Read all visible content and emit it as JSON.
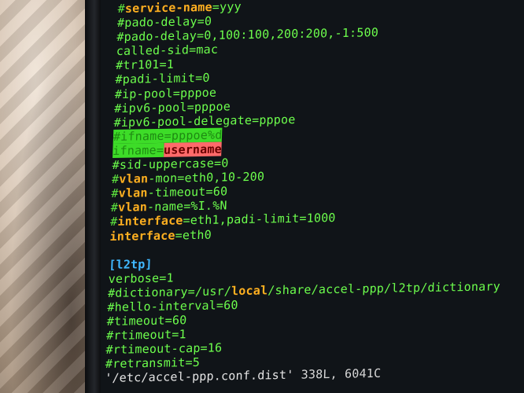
{
  "lines": [
    {
      "segs": [
        {
          "t": "#",
          "k": "c"
        },
        {
          "t": "service-name",
          "k": "kw"
        },
        {
          "t": "=yyy",
          "k": "val"
        }
      ]
    },
    {
      "segs": [
        {
          "t": "#pado-delay=0",
          "k": "val"
        }
      ]
    },
    {
      "segs": [
        {
          "t": "#pado-delay=0,100:100,200:200,-1:500",
          "k": "val"
        }
      ]
    },
    {
      "segs": [
        {
          "t": "called-sid=mac",
          "k": "val"
        }
      ]
    },
    {
      "segs": [
        {
          "t": "#tr101=1",
          "k": "val"
        }
      ]
    },
    {
      "segs": [
        {
          "t": "#padi-limit=0",
          "k": "val"
        }
      ]
    },
    {
      "segs": [
        {
          "t": "#ip-pool=pppoe",
          "k": "val"
        }
      ]
    },
    {
      "segs": [
        {
          "t": "#ipv6-pool=pppoe",
          "k": "val"
        }
      ]
    },
    {
      "segs": [
        {
          "t": "#ipv6-pool-delegate=pppoe",
          "k": "val"
        }
      ]
    },
    {
      "segs": [
        {
          "t": "#ifname=pppoe%d",
          "k": "hl-green"
        }
      ]
    },
    {
      "segs": [
        {
          "t": "ifname=",
          "k": "hl-green"
        },
        {
          "t": "username",
          "k": "hl-red"
        }
      ]
    },
    {
      "segs": [
        {
          "t": "#sid-uppercase=0",
          "k": "val"
        }
      ]
    },
    {
      "segs": [
        {
          "t": "#",
          "k": "c"
        },
        {
          "t": "vlan",
          "k": "kw"
        },
        {
          "t": "-mon=eth0,10-200",
          "k": "val"
        }
      ]
    },
    {
      "segs": [
        {
          "t": "#",
          "k": "c"
        },
        {
          "t": "vlan",
          "k": "kw"
        },
        {
          "t": "-timeout=60",
          "k": "val"
        }
      ]
    },
    {
      "segs": [
        {
          "t": "#",
          "k": "c"
        },
        {
          "t": "vlan",
          "k": "kw"
        },
        {
          "t": "-name=%I.%N",
          "k": "val"
        }
      ]
    },
    {
      "segs": [
        {
          "t": "#",
          "k": "c"
        },
        {
          "t": "interface",
          "k": "kw"
        },
        {
          "t": "=eth1,padi-limit=1000",
          "k": "val"
        }
      ]
    },
    {
      "segs": [
        {
          "t": "interface",
          "k": "kw"
        },
        {
          "t": "=eth0",
          "k": "val"
        }
      ]
    },
    {
      "segs": []
    },
    {
      "segs": [
        {
          "t": "[l2tp]",
          "k": "sect"
        }
      ]
    },
    {
      "segs": [
        {
          "t": "verbose=1",
          "k": "val"
        }
      ]
    },
    {
      "segs": [
        {
          "t": "#dictionary=/usr/",
          "k": "val"
        },
        {
          "t": "local",
          "k": "kw"
        },
        {
          "t": "/share/accel-ppp/l2tp/dictionary",
          "k": "val"
        }
      ]
    },
    {
      "segs": [
        {
          "t": "#hello-interval=60",
          "k": "val"
        }
      ]
    },
    {
      "segs": [
        {
          "t": "#timeout=60",
          "k": "val"
        }
      ]
    },
    {
      "segs": [
        {
          "t": "#rtimeout=1",
          "k": "val"
        }
      ]
    },
    {
      "segs": [
        {
          "t": "#rtimeout-cap=16",
          "k": "val"
        }
      ]
    },
    {
      "segs": [
        {
          "t": "#retransmit=5",
          "k": "val"
        }
      ]
    }
  ],
  "status_bar": {
    "file": "'/etc/accel-ppp.conf.dist'",
    "info": " 338L, 6041C"
  }
}
